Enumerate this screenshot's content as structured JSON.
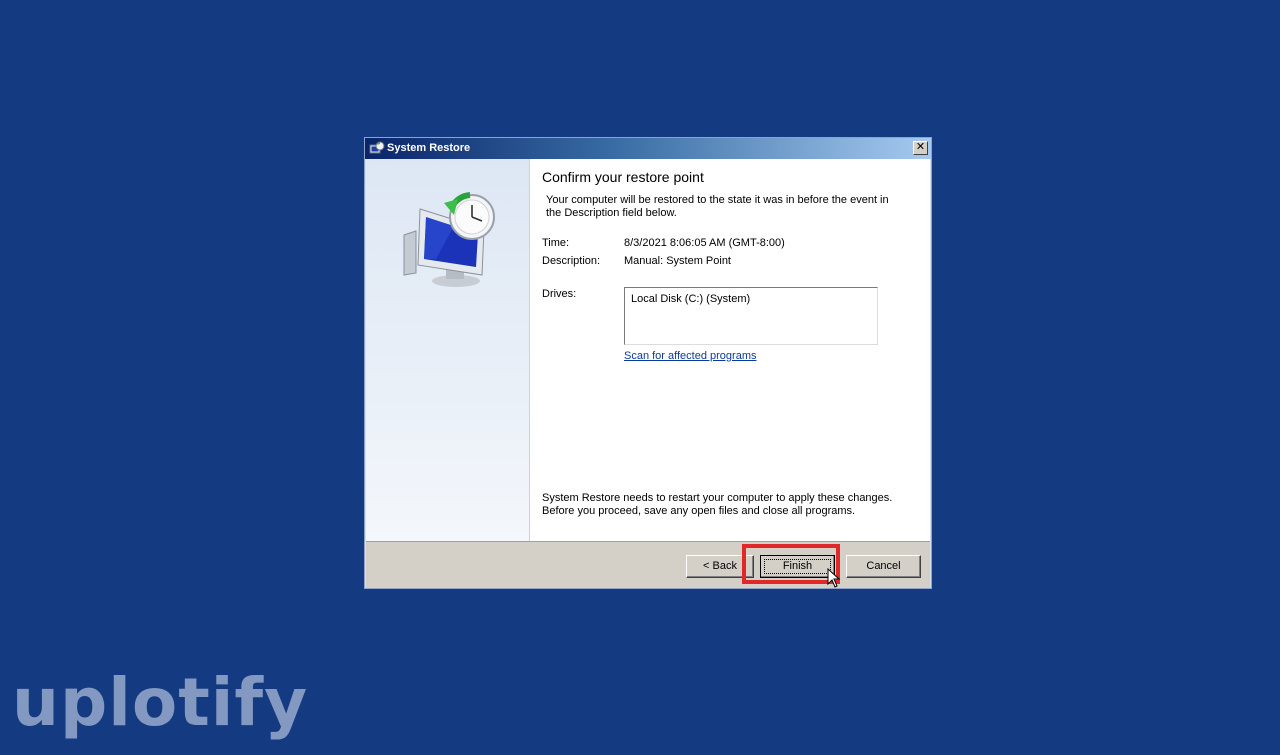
{
  "window": {
    "title": "System Restore",
    "close_glyph": "✕"
  },
  "content": {
    "heading": "Confirm your restore point",
    "intro": "Your computer will be restored to the state it was in before the event in the Description field below.",
    "time_label": "Time:",
    "time_value": "8/3/2021 8:06:05 AM (GMT-8:00)",
    "description_label": "Description:",
    "description_value": "Manual: System Point",
    "drives_label": "Drives:",
    "drives": [
      "Local Disk (C:) (System)"
    ],
    "scan_link": "Scan for affected programs",
    "notice": "System Restore needs to restart your computer to apply these changes. Before you proceed, save any open files and close all programs."
  },
  "buttons": {
    "back": "< Back",
    "finish": "Finish",
    "cancel": "Cancel"
  },
  "icons": {
    "title_icon": "system-restore-icon",
    "hero_icon": "monitor-clock-restore-icon",
    "cursor": "mouse-pointer-icon"
  },
  "colors": {
    "desktop": "#143a82",
    "highlight": "#e02828",
    "link": "#0b3a9c"
  },
  "watermark": "uplotify"
}
